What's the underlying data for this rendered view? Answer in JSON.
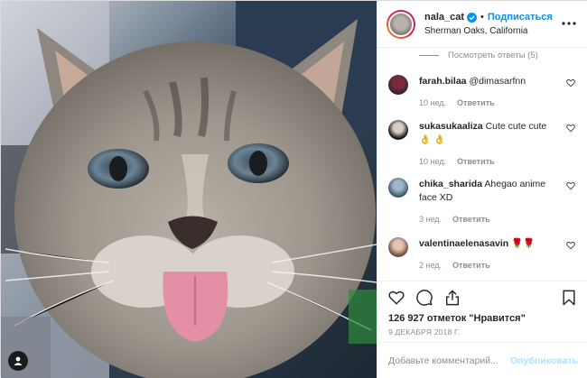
{
  "header": {
    "username": "nala_cat",
    "follow_label": "Подписаться",
    "separator": "•",
    "location": "Sherman Oaks, California"
  },
  "view_replies": "Посмотреть ответы (5)",
  "comments": [
    {
      "username": "farah.bilaa",
      "text": "@dimasarfnn",
      "time": "10 нед.",
      "reply": "Ответить"
    },
    {
      "username": "sukasukaaliza",
      "text": "Cute cute cute 👌 👌",
      "time": "10 нед.",
      "reply": "Ответить"
    },
    {
      "username": "chika_sharida",
      "text": "Ahegao anime face XD",
      "time": "3 нед.",
      "reply": "Ответить"
    },
    {
      "username": "valentinaelenasavin",
      "text": "🌹🌹",
      "time": "2 нед.",
      "reply": "Ответить"
    }
  ],
  "likes": "126 927 отметок \"Нравится\"",
  "date": "9 ДЕКАБРЯ 2018 Г.",
  "add_comment": {
    "placeholder": "Добавьте комментарий...",
    "publish_label": "Опубликовать"
  },
  "colors": {
    "accent": "#0095f6",
    "publish_disabled": "#b2dffc",
    "secondary_text": "#8e8e8e",
    "border": "#efefef"
  },
  "icons": [
    "verified-icon",
    "more-icon",
    "heart-icon",
    "comment-icon",
    "share-icon",
    "bookmark-icon",
    "user-tag-icon"
  ]
}
